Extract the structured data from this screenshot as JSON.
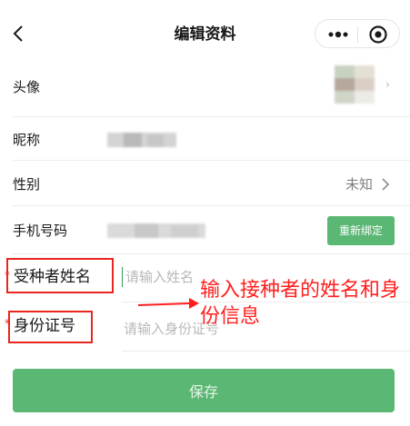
{
  "nav": {
    "title": "编辑资料",
    "more_icon": "ellipsis-icon",
    "record_icon": "target-icon"
  },
  "profile": {
    "avatar": {
      "label": "头像"
    },
    "nickname": {
      "label": "昵称"
    },
    "gender": {
      "label": "性别",
      "value": "未知"
    },
    "phone": {
      "label": "手机号码",
      "rebind_label": "重新绑定"
    }
  },
  "form": {
    "required_mark": "*",
    "name": {
      "label": "受种者姓名",
      "placeholder": "请输入姓名"
    },
    "id_card": {
      "label": "身份证号",
      "placeholder": "请输入身份证号"
    }
  },
  "annotation": {
    "text": "输入接种者的姓名和身份信息",
    "color": "#ff1e1e"
  },
  "actions": {
    "save_label": "保存"
  },
  "colors": {
    "primary": "#5bb774",
    "annotation_red": "#e8261d"
  }
}
